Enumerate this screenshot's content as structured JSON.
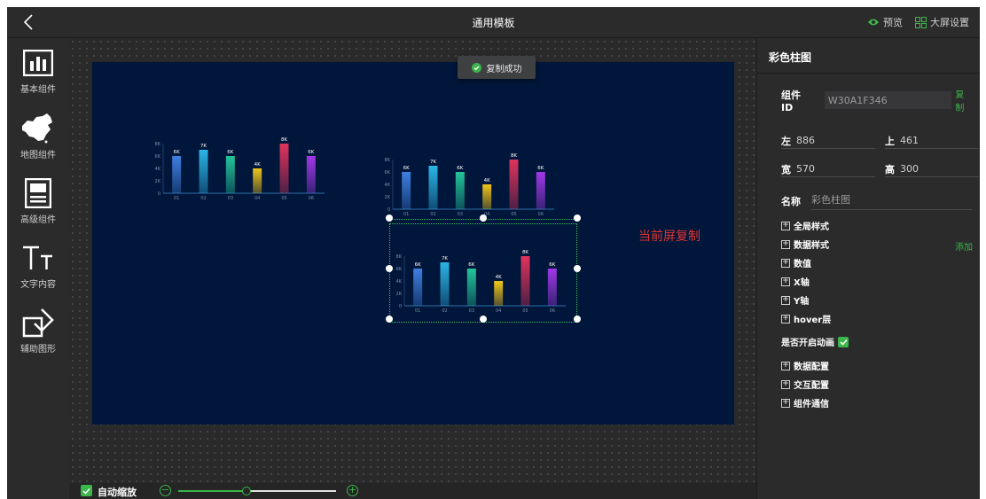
{
  "header": {
    "title": "通用模板",
    "preview_label": "预览",
    "screen_settings_label": "大屏设置"
  },
  "sidebar": {
    "items": [
      {
        "label": "基本组件",
        "icon": "bar-chart-icon"
      },
      {
        "label": "地图组件",
        "icon": "china-map-icon"
      },
      {
        "label": "高级组件",
        "icon": "advanced-component-icon"
      },
      {
        "label": "文字内容",
        "icon": "text-icon"
      },
      {
        "label": "辅助图形",
        "icon": "shapes-icon"
      }
    ]
  },
  "canvas": {
    "toast": "复制成功",
    "copy_note": "当前屏复制"
  },
  "zoom": {
    "label": "自动缩放",
    "checked": true,
    "level": 0.43
  },
  "panel": {
    "title": "彩色柱图",
    "id_label": "组件ID",
    "id_value": "W30A1F346",
    "id_copy": "复制",
    "left_label": "左",
    "left_value": "886",
    "top_label": "上",
    "top_value": "461",
    "width_label": "宽",
    "width_value": "570",
    "height_label": "高",
    "height_value": "300",
    "name_label": "名称",
    "name_value": "彩色柱图",
    "sections_a": [
      "全局样式",
      "数据样式",
      "数值",
      "X轴",
      "Y轴",
      "hover层"
    ],
    "add_label": "添加",
    "animation_label": "是否开启动画",
    "animation_on": true,
    "sections_b": [
      "数据配置",
      "交互配置",
      "组件通信"
    ]
  },
  "chart_data": [
    {
      "type": "bar",
      "categories": [
        "01",
        "02",
        "03",
        "04",
        "05",
        "06"
      ],
      "values": [
        6,
        7,
        6,
        4,
        8,
        6
      ],
      "value_labels": [
        "6K",
        "7K",
        "6K",
        "4K",
        "8K",
        "6K"
      ],
      "y_ticks": [
        "0",
        "2K",
        "4K",
        "6K",
        "8K"
      ],
      "ylim": [
        0,
        8
      ],
      "colors": [
        "#3f7fe0",
        "#2bb5e6",
        "#24c49a",
        "#f0c419",
        "#e0335c",
        "#a238e8"
      ]
    },
    {
      "type": "bar",
      "categories": [
        "01",
        "02",
        "03",
        "04",
        "05",
        "06"
      ],
      "values": [
        6,
        7,
        6,
        4,
        8,
        6
      ],
      "value_labels": [
        "6K",
        "7K",
        "6K",
        "4K",
        "8K",
        "6K"
      ],
      "y_ticks": [
        "0",
        "2K",
        "4K",
        "6K",
        "8K"
      ],
      "ylim": [
        0,
        8
      ],
      "colors": [
        "#3f7fe0",
        "#2bb5e6",
        "#24c49a",
        "#f0c419",
        "#e0335c",
        "#a238e8"
      ]
    },
    {
      "type": "bar",
      "categories": [
        "01",
        "02",
        "03",
        "04",
        "05",
        "06"
      ],
      "values": [
        6,
        7,
        6,
        4,
        8,
        6
      ],
      "value_labels": [
        "6K",
        "7K",
        "6K",
        "4K",
        "8K",
        "6K"
      ],
      "y_ticks": [
        "0",
        "2K",
        "4K",
        "6K",
        "8K"
      ],
      "ylim": [
        0,
        8
      ],
      "colors": [
        "#3f7fe0",
        "#2bb5e6",
        "#24c49a",
        "#f0c419",
        "#e0335c",
        "#a238e8"
      ]
    }
  ]
}
